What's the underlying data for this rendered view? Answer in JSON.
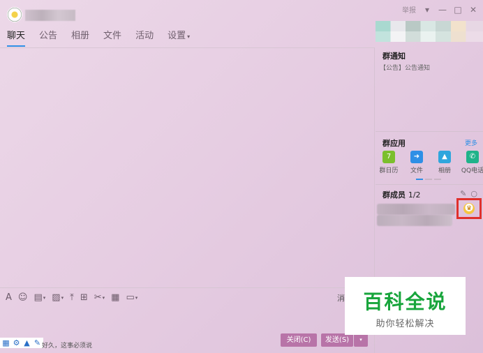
{
  "window": {
    "report": "举报",
    "controls": {
      "dropdown": "▾",
      "minimize": "—",
      "maximize": "□",
      "close": "✕"
    }
  },
  "tabs": [
    {
      "label": "聊天"
    },
    {
      "label": "公告"
    },
    {
      "label": "相册"
    },
    {
      "label": "文件"
    },
    {
      "label": "活动"
    },
    {
      "label": "设置",
      "caret": "▾"
    }
  ],
  "toolbar": {
    "history_label": "消"
  },
  "input": {
    "hint": "好久，这事必须说"
  },
  "buttons": {
    "close": "关闭(C)",
    "send": "发送(S)",
    "send_dropdown": "▾"
  },
  "notice": {
    "title": "群通知",
    "text": "【公告】公告通知"
  },
  "apps": {
    "title": "群应用",
    "more": "更多",
    "items": [
      {
        "label": "群日历",
        "icon": "calendar-icon",
        "glyph": "7",
        "color": "#7bbf2d"
      },
      {
        "label": "文件",
        "icon": "folder-icon",
        "glyph": "➜",
        "color": "#2e8fe6"
      },
      {
        "label": "相册",
        "icon": "picture-icon",
        "glyph": "▲",
        "color": "#2fa6dd"
      },
      {
        "label": "QQ电话",
        "icon": "phone-icon",
        "glyph": "✆",
        "color": "#1fb38a"
      }
    ]
  },
  "members": {
    "title": "群成员",
    "count": "1/2"
  },
  "watermark": {
    "title": "百科全说",
    "subtitle": "助你轻松解决"
  }
}
